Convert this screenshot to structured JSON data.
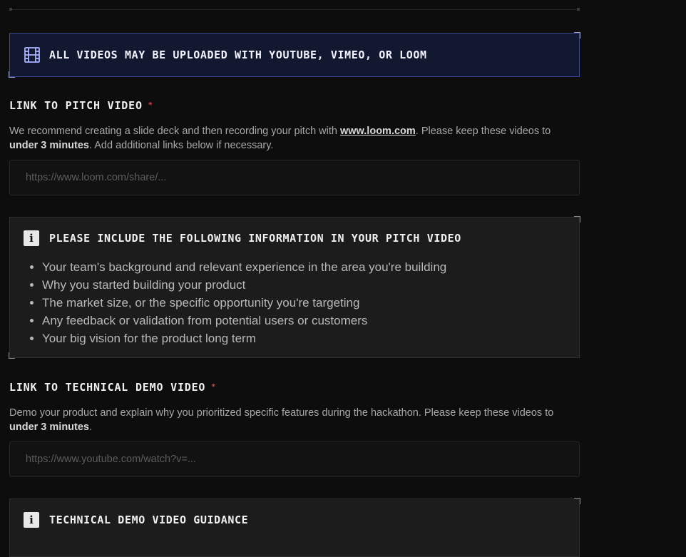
{
  "banner": {
    "icon": "film-icon",
    "text": "ALL VIDEOS MAY BE UPLOADED WITH YOUTUBE, VIMEO, OR LOOM"
  },
  "pitch": {
    "label": "LINK TO PITCH VIDEO",
    "required_mark": "*",
    "desc_prefix": "We recommend creating a slide deck and then recording your pitch with ",
    "desc_link": "www.loom.com",
    "desc_mid": ". Please keep these videos to ",
    "desc_bold": "under 3 minutes",
    "desc_suffix": ". Add additional links below if necessary.",
    "placeholder": "https://www.loom.com/share/..."
  },
  "pitch_info": {
    "icon": "info-icon",
    "icon_glyph": "i",
    "title": "PLEASE INCLUDE THE FOLLOWING INFORMATION IN YOUR PITCH VIDEO",
    "items": [
      "Your team's background and relevant experience in the area you're building",
      "Why you started building your product",
      "The market size, or the specific opportunity you're targeting",
      "Any feedback or validation from potential users or customers",
      "Your big vision for the product long term"
    ]
  },
  "demo": {
    "label": "LINK TO TECHNICAL DEMO VIDEO",
    "required_mark": "*",
    "desc_prefix": "Demo your product and explain why you prioritized specific features during the hackathon. Please keep these videos to ",
    "desc_bold": "under 3 minutes",
    "desc_suffix": ".",
    "placeholder": "https://www.youtube.com/watch?v=..."
  },
  "demo_info": {
    "icon": "info-icon",
    "icon_glyph": "i",
    "title": "TECHNICAL DEMO VIDEO GUIDANCE"
  },
  "colors": {
    "background": "#0d0d0d",
    "banner_bg": "#131831",
    "banner_border": "#3b4590",
    "required": "#e5484d"
  }
}
